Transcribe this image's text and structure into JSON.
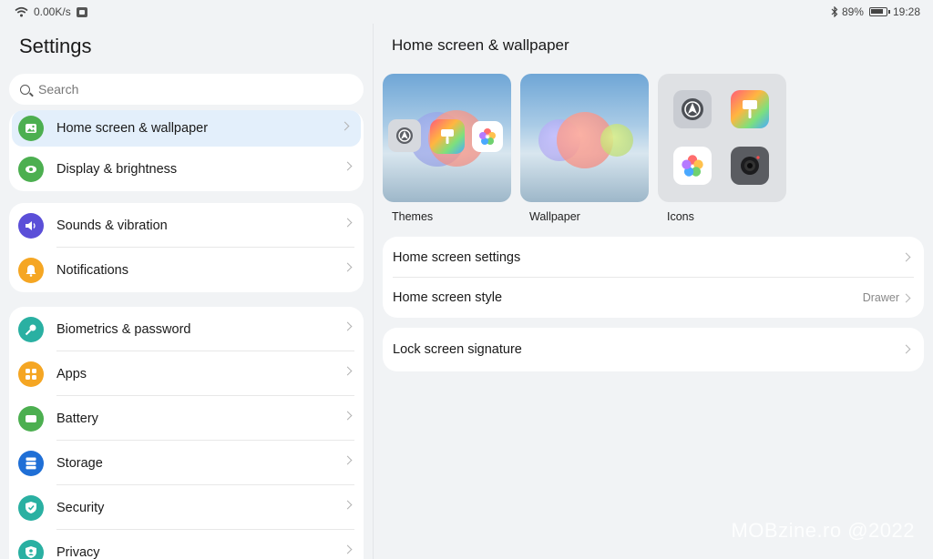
{
  "status_bar": {
    "net_speed": "0.00K/s",
    "battery": "89%",
    "battery_level": 0.89,
    "time": "19:28"
  },
  "left": {
    "title": "Settings",
    "search_placeholder": "Search",
    "groups": [
      [
        {
          "label": "Home screen & wallpaper",
          "icon": "image-icon",
          "color": "#4caf50",
          "selected": true
        },
        {
          "label": "Display & brightness",
          "icon": "eye-icon",
          "color": "#4caf50"
        }
      ],
      [
        {
          "label": "Sounds & vibration",
          "icon": "speaker-icon",
          "color": "#5b4fd8"
        },
        {
          "label": "Notifications",
          "icon": "bell-icon",
          "color": "#f5a623"
        }
      ],
      [
        {
          "label": "Biometrics & password",
          "icon": "key-icon",
          "color": "#2ab0a2"
        },
        {
          "label": "Apps",
          "icon": "apps-grid-icon",
          "color": "#f5a623"
        },
        {
          "label": "Battery",
          "icon": "battery-icon",
          "color": "#4caf50"
        },
        {
          "label": "Storage",
          "icon": "storage-icon",
          "color": "#1f6fd6"
        },
        {
          "label": "Security",
          "icon": "shield-check-icon",
          "color": "#2ab0a2"
        },
        {
          "label": "Privacy",
          "icon": "privacy-shield-icon",
          "color": "#2ab0a2"
        }
      ]
    ]
  },
  "right": {
    "title": "Home screen & wallpaper",
    "thumbs": {
      "themes": "Themes",
      "wallpaper": "Wallpaper",
      "icons": "Icons"
    },
    "rows": {
      "home_settings": "Home screen settings",
      "home_style": "Home screen style",
      "home_style_value": "Drawer",
      "lock_signature": "Lock screen signature"
    }
  },
  "watermark": "MOBzine.ro @2022"
}
